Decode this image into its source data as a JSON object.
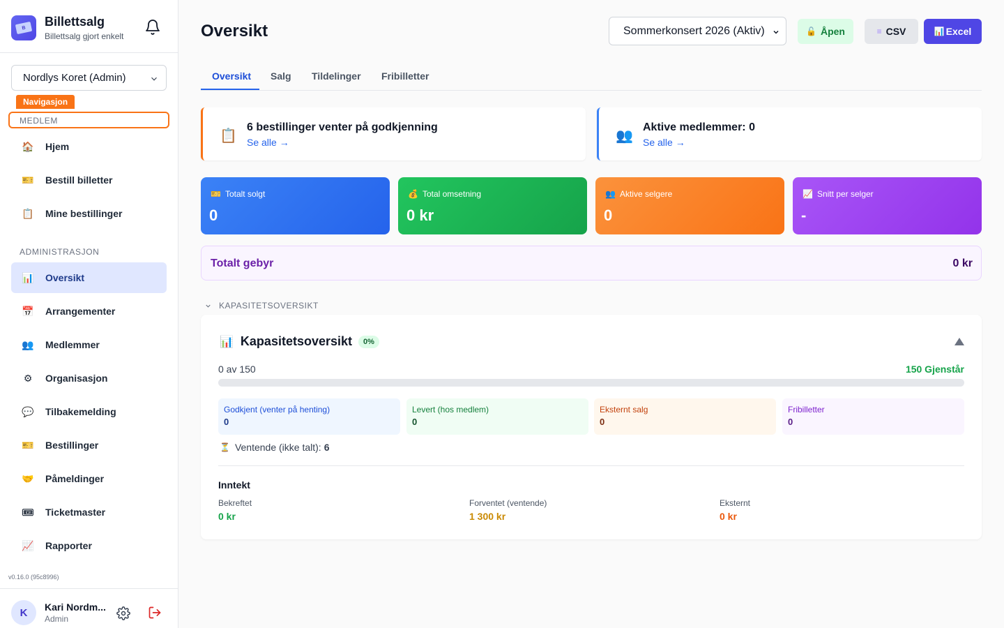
{
  "brand": {
    "title": "Billettsalg",
    "subtitle": "Billettsalg gjort enkelt"
  },
  "org_selector": {
    "value": "Nordlys Koret (Admin)"
  },
  "nav_badge": "Navigasjon",
  "sections": {
    "member": "MEDLEM",
    "admin": "ADMINISTRASJON"
  },
  "member_items": [
    {
      "label": "Hjem",
      "icon": "house-icon"
    },
    {
      "label": "Bestill billetter",
      "icon": "ticket-icon"
    },
    {
      "label": "Mine bestillinger",
      "icon": "clipboard-icon"
    }
  ],
  "admin_items": [
    {
      "label": "Oversikt",
      "icon": "bar-chart-icon"
    },
    {
      "label": "Arrangementer",
      "icon": "calendar-icon"
    },
    {
      "label": "Medlemmer",
      "icon": "users-icon"
    },
    {
      "label": "Organisasjon",
      "icon": "gear-icon"
    },
    {
      "label": "Tilbakemelding",
      "icon": "speech-bubble-icon"
    },
    {
      "label": "Bestillinger",
      "icon": "ticket-icon"
    },
    {
      "label": "Påmeldinger",
      "icon": "handshake-icon"
    },
    {
      "label": "Ticketmaster",
      "icon": "admission-ticket-icon"
    },
    {
      "label": "Rapporter",
      "icon": "trend-chart-icon"
    }
  ],
  "version": "v0.16.0 (95c8996)",
  "user": {
    "initial": "K",
    "name": "Kari Nordm...",
    "role": "Admin"
  },
  "header": {
    "title": "Oversikt",
    "event_select": "Sommerkonsert 2026 (Aktiv)",
    "open_button": "Åpen",
    "csv_button": "CSV",
    "excel_button": "Excel"
  },
  "tabs": [
    "Oversikt",
    "Salg",
    "Tildelinger",
    "Fribilletter"
  ],
  "alerts": {
    "pending": {
      "title": "6 bestillinger venter på godkjenning",
      "link": "Se alle →"
    },
    "members": {
      "title": "Aktive medlemmer: 0",
      "link": "Se alle →"
    }
  },
  "stats": [
    {
      "label": "Totalt solgt",
      "value": "0",
      "icon": "ticket-icon"
    },
    {
      "label": "Total omsetning",
      "value": "0 kr",
      "icon": "money-bag-icon"
    },
    {
      "label": "Aktive selgere",
      "value": "0",
      "icon": "users-icon"
    },
    {
      "label": "Snitt per selger",
      "value": "-",
      "icon": "trend-chart-icon"
    }
  ],
  "fee": {
    "label": "Totalt gebyr",
    "value": "0 kr"
  },
  "capacity": {
    "section_header": "KAPASITETSOVERSIKT",
    "title": "Kapasitetsoversikt",
    "percent": "0%",
    "progress_fraction": 0,
    "count": "0 av 150",
    "remaining": "150 Gjenstår",
    "boxes": [
      {
        "label": "Godkjent (venter på henting)",
        "value": "0"
      },
      {
        "label": "Levert (hos medlem)",
        "value": "0"
      },
      {
        "label": "Eksternt salg",
        "value": "0"
      },
      {
        "label": "Fribilletter",
        "value": "0"
      }
    ],
    "waiting_label": "Ventende (ikke talt):",
    "waiting_value": "6"
  },
  "income": {
    "title": "Inntekt",
    "items": [
      {
        "label": "Bekreftet",
        "value": "0 kr"
      },
      {
        "label": "Forventet (ventende)",
        "value": "1 300 kr"
      },
      {
        "label": "Eksternt",
        "value": "0 kr"
      }
    ]
  },
  "colors": {
    "accent": "#4f46e5",
    "highlight": "#f97316",
    "active_nav": "#e0e7ff"
  }
}
